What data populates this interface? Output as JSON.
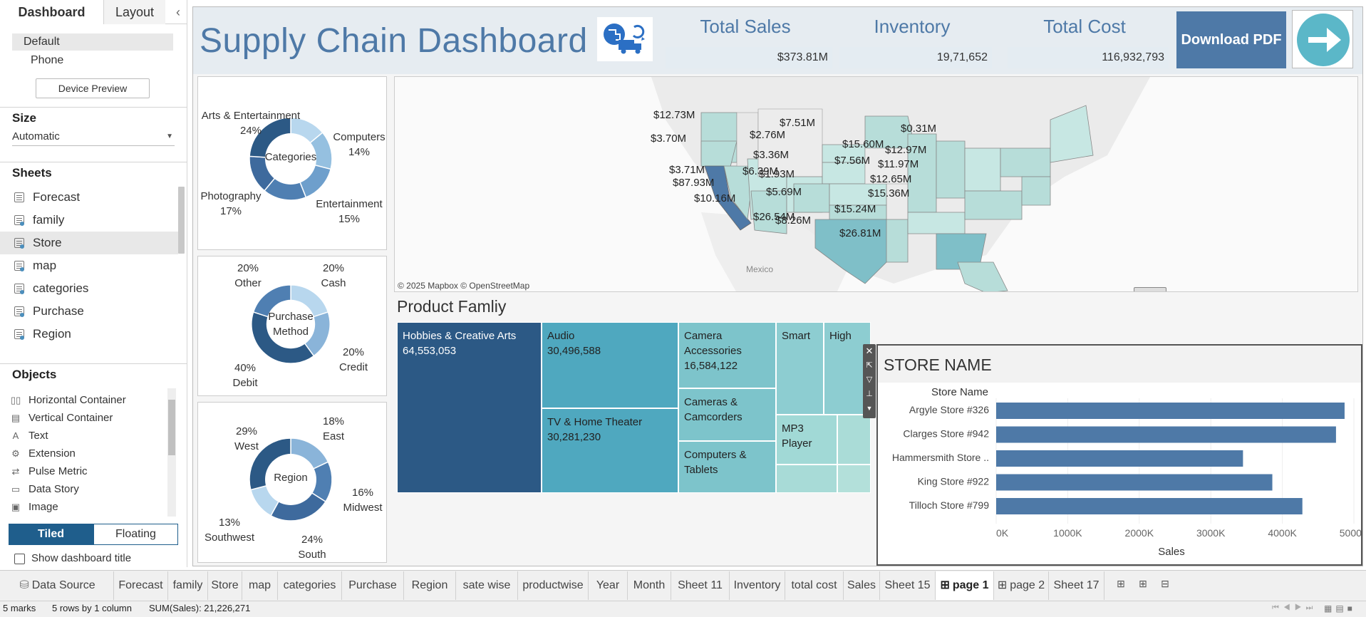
{
  "left_pane": {
    "tabs": [
      "Dashboard",
      "Layout"
    ],
    "collapse_icon": "chevron-left-icon",
    "device": {
      "items": [
        "Default",
        "Phone"
      ],
      "preview_button": "Device Preview"
    },
    "size": {
      "heading": "Size",
      "value": "Automatic"
    },
    "sheets": {
      "heading": "Sheets",
      "items": [
        "Forecast",
        "family",
        "Store",
        "map",
        "categories",
        "Purchase",
        "Region"
      ]
    },
    "objects": {
      "heading": "Objects",
      "items": [
        "Horizontal Container",
        "Vertical Container",
        "Text",
        "Extension",
        "Pulse Metric",
        "Data Story",
        "Image"
      ]
    },
    "layout_toggle": {
      "tiled": "Tiled",
      "floating": "Floating"
    },
    "show_title_label": "Show dashboard title"
  },
  "dashboard": {
    "title": "Supply Chain Dashboard",
    "kpis": [
      {
        "label": "Total Sales",
        "value": "$373.81M"
      },
      {
        "label": "Inventory",
        "value": "19,71,652"
      },
      {
        "label": "Total Cost",
        "value": "116,932,793"
      }
    ],
    "download_button": "Download PDF",
    "colors": {
      "accent": "#4e79a7",
      "dark": "#2c5985",
      "teal": "#4fa8bf"
    },
    "categories_donut": {
      "center": "Categories",
      "labels": [
        {
          "name": "Arts & Entertainment",
          "pct": "24%"
        },
        {
          "name": "Computers",
          "pct": "14%"
        },
        {
          "name": "Photography",
          "pct": "17%"
        },
        {
          "name": "Entertainment",
          "pct": "15%"
        }
      ]
    },
    "purchase_donut": {
      "center": "Purchase Method",
      "labels": [
        {
          "name": "Other",
          "pct": "20%"
        },
        {
          "name": "Cash",
          "pct": "20%"
        },
        {
          "name": "Credit",
          "pct": "20%"
        },
        {
          "name": "Debit",
          "pct": "40%"
        }
      ]
    },
    "region_donut": {
      "center": "Region",
      "labels": [
        {
          "name": "East",
          "pct": "18%"
        },
        {
          "name": "West",
          "pct": "29%"
        },
        {
          "name": "Midwest",
          "pct": "16%"
        },
        {
          "name": "Southwest",
          "pct": "13%"
        },
        {
          "name": "South",
          "pct": "24%"
        }
      ]
    },
    "map": {
      "labels": [
        "$12.73M",
        "$3.70M",
        "$3.71M",
        "$87.93M",
        "$10.16M",
        "$7.51M",
        "$2.76M",
        "$3.36M",
        "$6.39M",
        "$1.93M",
        "$5.69M",
        "$26.54M",
        "$8.26M",
        "$15.60M",
        "$7.56M",
        "$11.97M",
        "$12.97M",
        "$0.31M",
        "$12.65M",
        "$15.36M",
        "$15.24M",
        "$26.81M"
      ],
      "country_label": "Mexico",
      "attribution": "© 2025 Mapbox © OpenStreetMap"
    },
    "product_family": {
      "title": "Product Famliy",
      "tiles": [
        {
          "name": "Hobbies & Creative Arts",
          "value": "64,553,053"
        },
        {
          "name": "Audio",
          "value": "30,496,588"
        },
        {
          "name": "TV & Home Theater",
          "value": "30,281,230"
        },
        {
          "name": "Camera Accessories",
          "value": "16,584,122"
        },
        {
          "name": "Cameras & Camcorders",
          "value": ""
        },
        {
          "name": "Computers & Tablets",
          "value": ""
        },
        {
          "name": "Smart",
          "value": ""
        },
        {
          "name": "High",
          "value": ""
        },
        {
          "name": "MP3 Player",
          "value": ""
        }
      ]
    },
    "store_chart": {
      "title": "STORE NAME",
      "column_header": "Store Name",
      "xlabel": "Sales",
      "ticks": [
        "0K",
        "1000K",
        "2000K",
        "3000K",
        "4000K",
        "5000K"
      ]
    }
  },
  "chart_data": {
    "type": "bar",
    "title": "STORE NAME",
    "xlabel": "Sales",
    "ylabel": "Store Name",
    "categories": [
      "Argyle Store #326",
      "Clarges Store #942",
      "Hammersmith Store ..",
      "King Store #922",
      "Tilloch Store #799"
    ],
    "values": [
      4870000,
      4750000,
      3450000,
      3860000,
      4280000
    ],
    "xlim": [
      0,
      5000000
    ],
    "orientation": "horizontal",
    "bar_color": "#4e79a7"
  },
  "bottom_tabs": [
    "Data Source",
    "Forecast",
    "family",
    "Store",
    "map",
    "categories",
    "Purchase",
    "Region",
    "sate wise",
    "productwise",
    "Year",
    "Month",
    "Sheet 11",
    "Inventory",
    "total cost",
    "Sales",
    "Sheet 15",
    "page 1",
    "page 2",
    "Sheet 17"
  ],
  "status_bar": {
    "marks": "5 marks",
    "rows": "5 rows by 1 column",
    "sum": "SUM(Sales): 21,226,271"
  }
}
